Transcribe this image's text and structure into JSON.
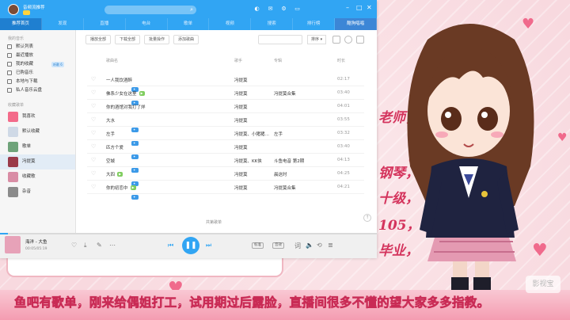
{
  "window": {
    "user_name": "音频流推荐",
    "tabs": [
      "推荐首页",
      "发现",
      "直播",
      "电台",
      "歌单",
      "视频",
      "搜索",
      "排行榜",
      "酷狗唱唱"
    ]
  },
  "sidebar": {
    "head_mine": "我的音乐",
    "items": [
      {
        "label": "默认列表"
      },
      {
        "label": "最近播放"
      },
      {
        "label": "我的收藏",
        "tag": "听歌 6"
      },
      {
        "label": "已购音乐"
      },
      {
        "label": "本地与下载"
      },
      {
        "label": "私人音乐云盘"
      }
    ],
    "head_playlists": "收藏歌单",
    "playlists": [
      "我喜欢",
      "默认收藏",
      "歌单",
      "冯提莫",
      "收藏歌",
      "杂音"
    ]
  },
  "toolbar": {
    "buttons": [
      "播放全部",
      "下载全部",
      "批量操作",
      "添加歌曲"
    ],
    "sort_label": "排序 ▾"
  },
  "table": {
    "headers": {
      "title": "歌曲名",
      "artist": "歌手",
      "album": "专辑",
      "duration": "时长"
    },
    "rows": [
      {
        "title": "一人我饮酒醉",
        "badges": [
          "vip"
        ],
        "artist": "冯提莫",
        "album": "",
        "duration": "02:17"
      },
      {
        "title": "佛系少女在这里",
        "badges": [
          "vip",
          "mv"
        ],
        "artist": "冯提莫",
        "album": "冯提莫合集",
        "duration": "03:40"
      },
      {
        "title": "你的酒馆对我打了烊",
        "badges": [],
        "artist": "冯提莫",
        "album": "",
        "duration": "04:01"
      },
      {
        "title": "大水",
        "badges": [
          "vip"
        ],
        "artist": "冯提莫",
        "album": "",
        "duration": "03:55"
      },
      {
        "title": "左手",
        "badges": [
          "vip",
          "vip"
        ],
        "artist": "冯提莫、小猪猪…",
        "album": "左手",
        "duration": "03:32"
      },
      {
        "title": "匹方个爱",
        "badges": [
          "vip"
        ],
        "artist": "冯提莫",
        "album": "",
        "duration": "03:40"
      },
      {
        "title": "空城",
        "badges": [
          "vip",
          "vip"
        ],
        "artist": "冯提莫、KK侠",
        "album": "斗鱼电音 第2期",
        "duration": "04:13"
      },
      {
        "title": "大四",
        "badges": [
          "mv",
          "vip"
        ],
        "artist": "冯提莫",
        "album": "晨这时",
        "duration": "04:25"
      },
      {
        "title": "你的初恋中",
        "badges": [
          "mv",
          "vip"
        ],
        "artist": "冯提莫",
        "album": "冯提莫合集",
        "duration": "04:21"
      }
    ],
    "footer": "共第歌单"
  },
  "player": {
    "title": "海洋 - 大鱼",
    "time": "00:05/05:19",
    "progress": 0.02,
    "quality": "标准",
    "mode": "音效"
  },
  "overlay": {
    "handwriting": [
      "老师，",
      "钢琴，",
      "十级，",
      "105，",
      "毕业，"
    ],
    "caption": "鱼吧有歌单，刚来给偶姐打工，试用期过后露脸，直播间很多不懂的望大家多多指教。",
    "watermark": "影视宝"
  },
  "colors": {
    "accent": "#31a5f3",
    "caption_stroke": "#c92b55",
    "background": "#f7dbe0"
  }
}
